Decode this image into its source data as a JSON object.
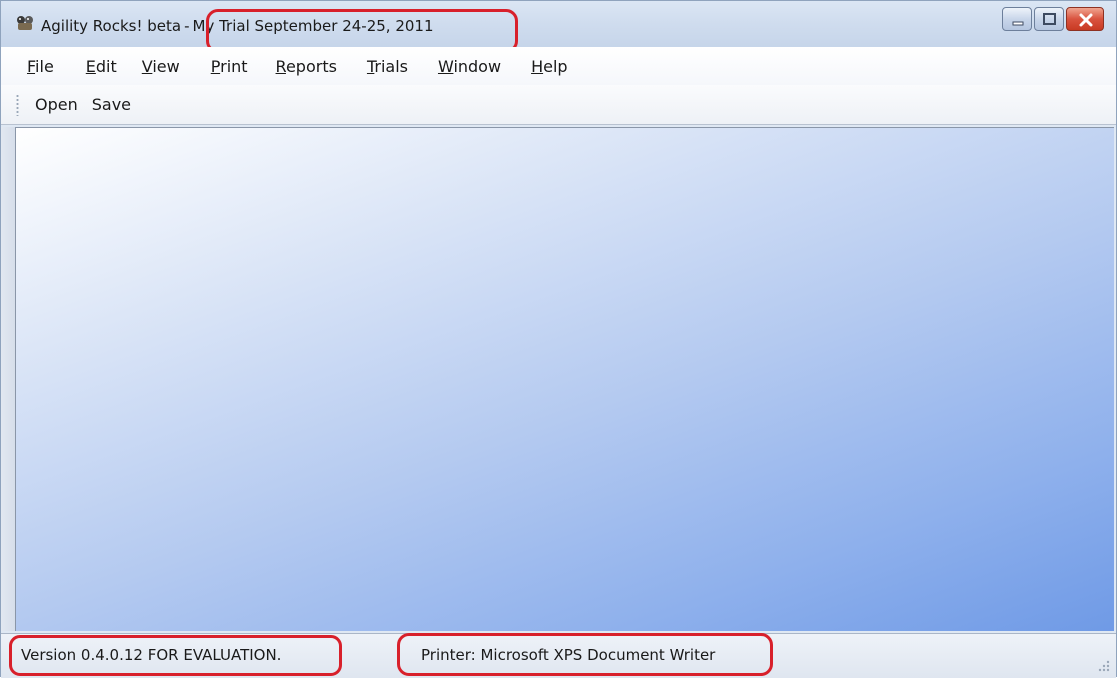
{
  "window": {
    "app_title": "Agility Rocks! beta",
    "separator": "-",
    "document_title": "My Trial September 24-25, 2011"
  },
  "menu": {
    "items": [
      {
        "label": "File",
        "accel": "F",
        "rest": "ile"
      },
      {
        "label": "Edit",
        "accel": "E",
        "rest": "dit"
      },
      {
        "label": "View",
        "accel": "V",
        "rest": "iew"
      },
      {
        "label": "Print",
        "accel": "P",
        "rest": "rint"
      },
      {
        "label": "Reports",
        "accel": "R",
        "rest": "eports"
      },
      {
        "label": "Trials",
        "accel": "T",
        "rest": "rials"
      },
      {
        "label": "Window",
        "accel": "W",
        "rest": "indow"
      },
      {
        "label": "Help",
        "accel": "H",
        "rest": "elp"
      }
    ]
  },
  "toolbar": {
    "open_label": "Open",
    "save_label": "Save"
  },
  "status": {
    "version_text": "Version 0.4.0.12 FOR EVALUATION.",
    "printer_text": "Printer: Microsoft XPS Document Writer"
  },
  "colors": {
    "highlight": "#d8202b",
    "client_gradient_start": "#ffffff",
    "client_gradient_end": "#6f9ae6"
  }
}
